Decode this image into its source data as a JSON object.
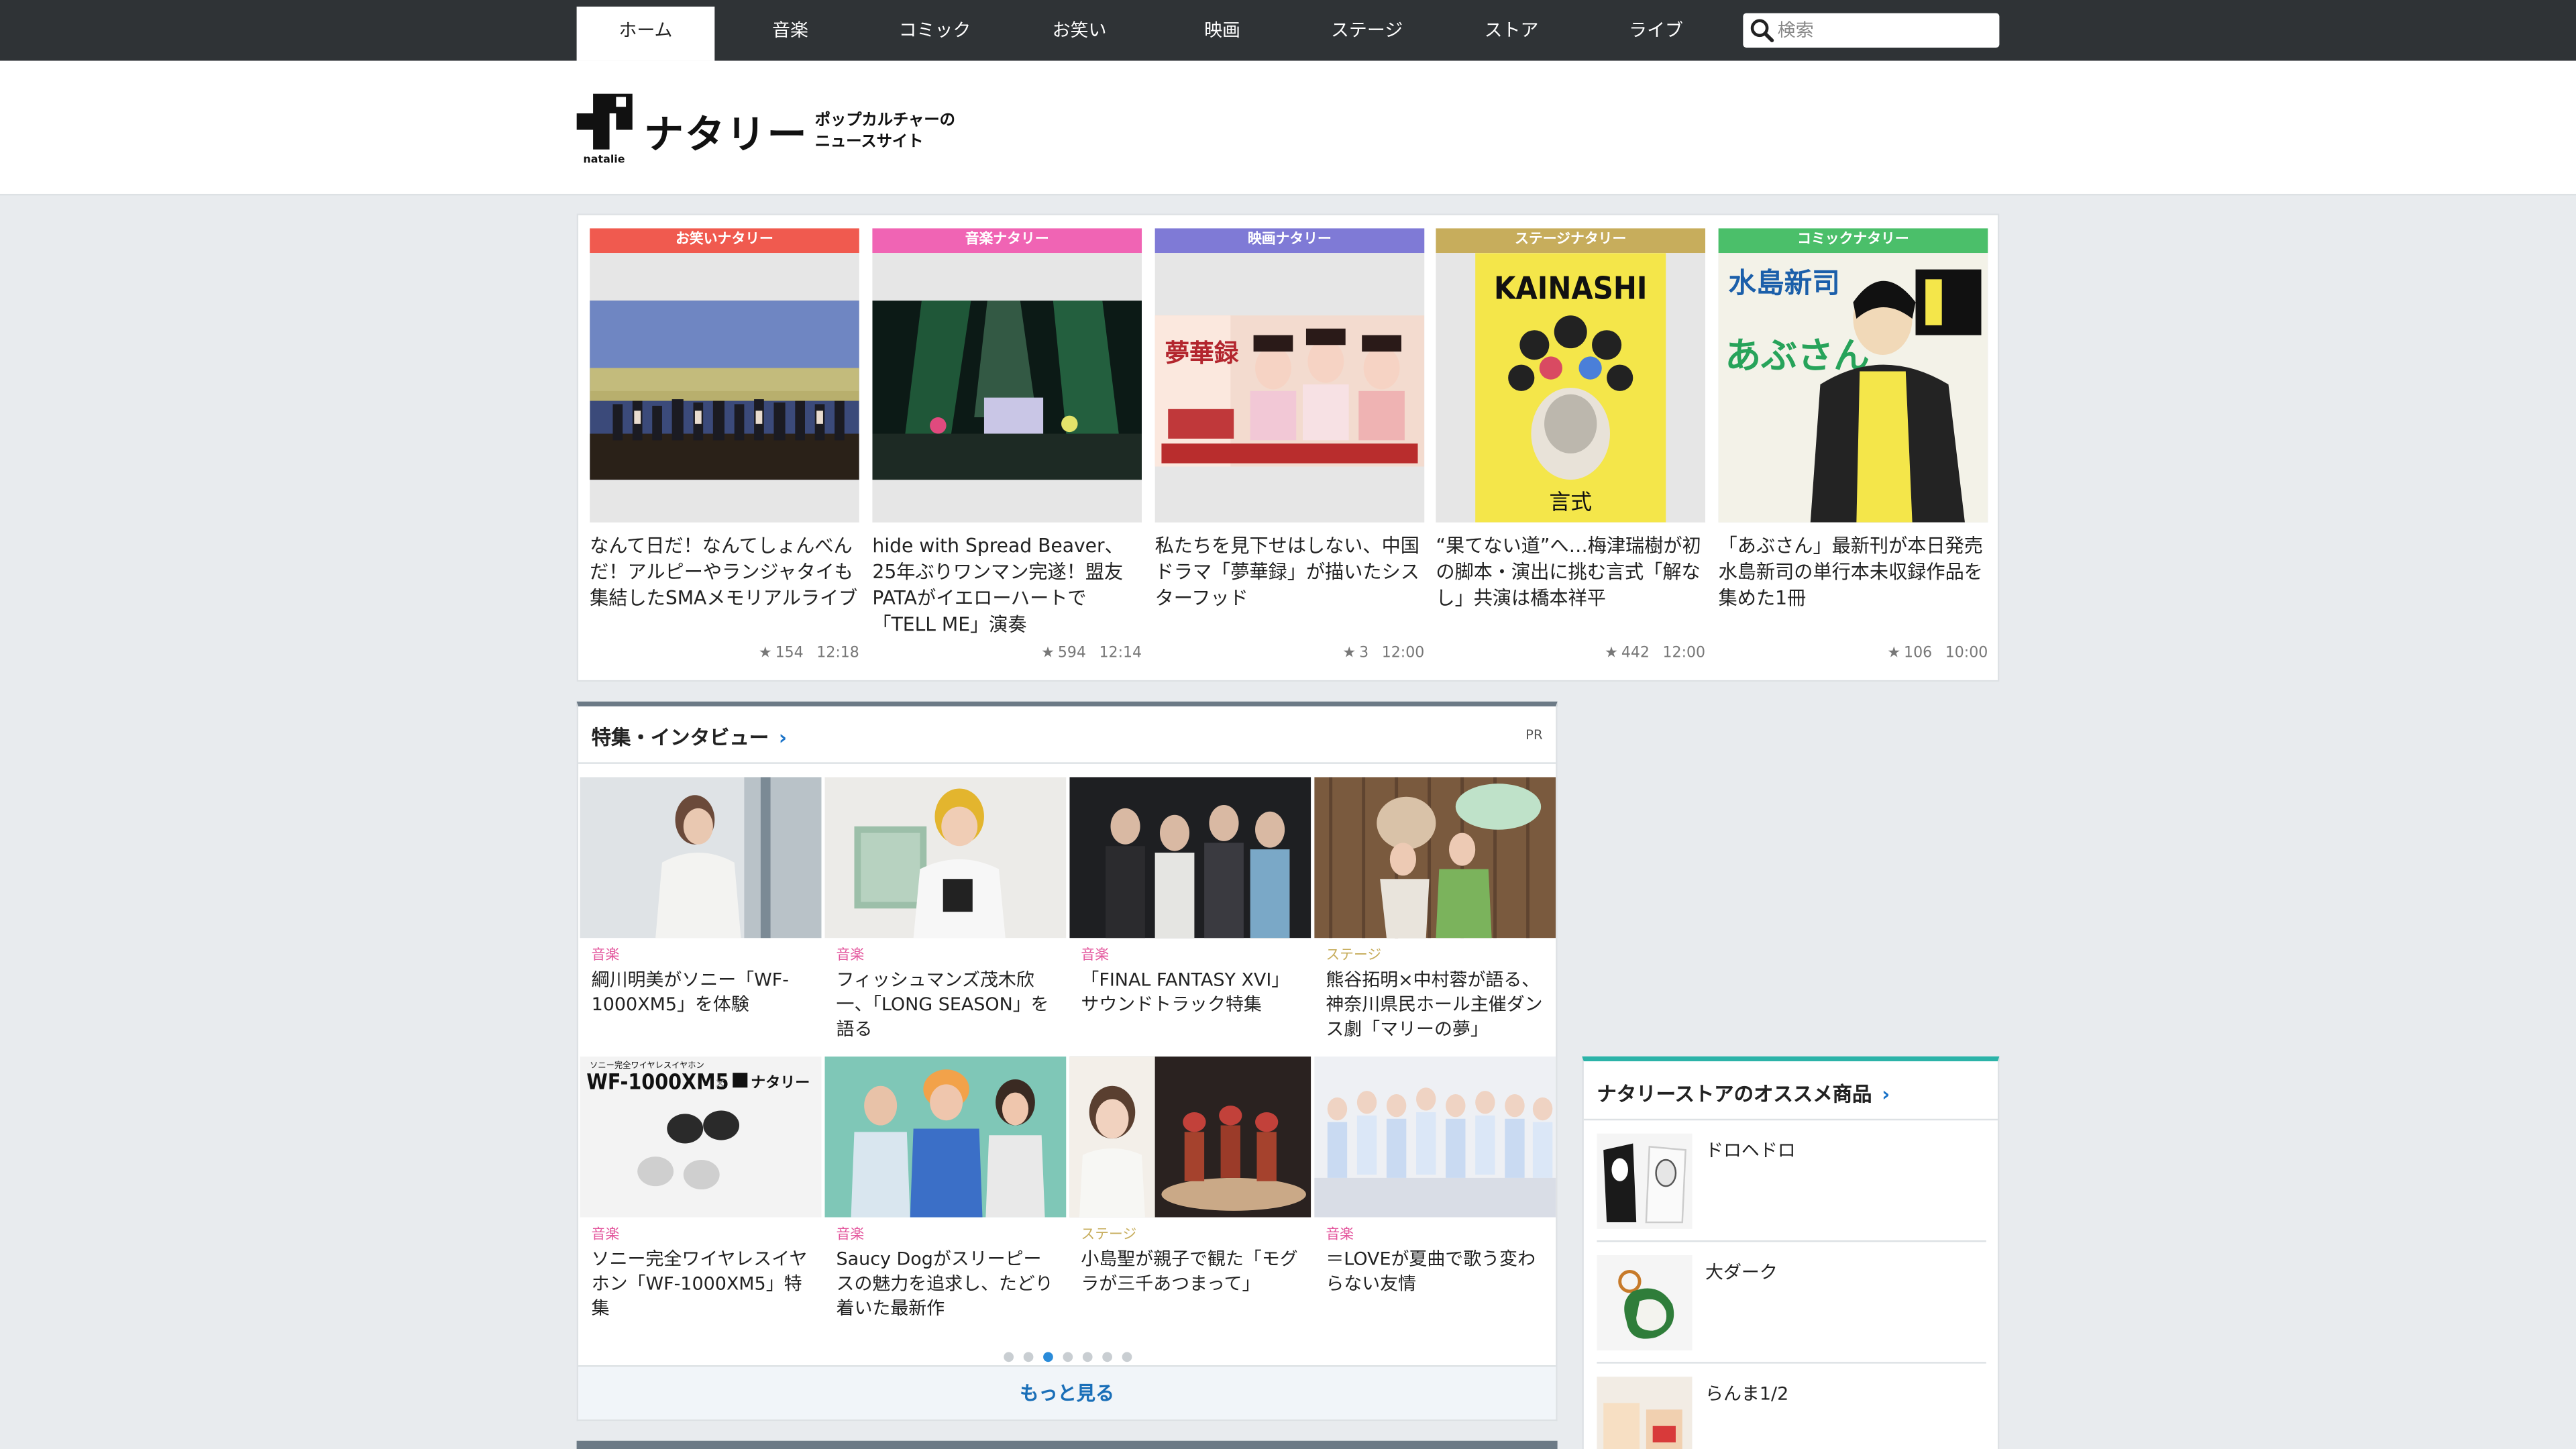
{
  "nav": {
    "tabs": [
      "ホーム",
      "音楽",
      "コミック",
      "お笑い",
      "映画",
      "ステージ",
      "ストア",
      "ライブ"
    ],
    "active_index": 0,
    "search_placeholder": "検索"
  },
  "header": {
    "logo_text": "ナタリー",
    "logo_sub": "natalie",
    "tagline_1": "ポップカルチャーの",
    "tagline_2": "ニュースサイト"
  },
  "picks": [
    {
      "badge": "お笑いナタリー",
      "badge_color": "#f05a4f",
      "title": "なんて日だ！なんてしょんべんだ！アルピーやランジャタイも集結したSMAメモリアルライブ",
      "count": "154",
      "time": "12:18"
    },
    {
      "badge": "音楽ナタリー",
      "badge_color": "#f064b4",
      "title": "hide with Spread Beaver、25年ぶりワンマン完遂！盟友PATAがイエローハートで「TELL ME」演奏",
      "count": "594",
      "time": "12:14"
    },
    {
      "badge": "映画ナタリー",
      "badge_color": "#7f7ad6",
      "title": "私たちを見下せはしない、中国ドラマ「夢華録」が描いたシスターフッド",
      "count": "3",
      "time": "12:00"
    },
    {
      "badge": "ステージナタリー",
      "badge_color": "#c7ad5c",
      "title": "“果てない道”へ…梅津瑞樹が初の脚本・演出に挑む言式「解なし」共演は橋本祥平",
      "count": "442",
      "time": "12:00"
    },
    {
      "badge": "コミックナタリー",
      "badge_color": "#4bbf6a",
      "title": "「あぶさん」最新刊が本日発売　水島新司の単行本未収録作品を集めた1冊",
      "count": "106",
      "time": "10:00"
    }
  ],
  "features": {
    "heading": "特集・インタビュー",
    "pr": "PR",
    "items": [
      {
        "cat": "音楽",
        "cat_color": "#e3559c",
        "title": "綱川明美がソニー「WF-1000XM5」を体験"
      },
      {
        "cat": "音楽",
        "cat_color": "#e3559c",
        "title": "フィッシュマンズ茂木欣一、「LONG SEASON」を語る"
      },
      {
        "cat": "音楽",
        "cat_color": "#e3559c",
        "title": "「FINAL FANTASY XVI」サウンドトラック特集"
      },
      {
        "cat": "ステージ",
        "cat_color": "#c7ad5c",
        "title": "熊谷拓明×中村蓉が語る、神奈川県民ホール主催ダンス劇「マリーの夢」"
      },
      {
        "cat": "音楽",
        "cat_color": "#e3559c",
        "title": "ソニー完全ワイヤレスイヤホン「WF-1000XM5」特集"
      },
      {
        "cat": "音楽",
        "cat_color": "#e3559c",
        "title": "Saucy Dogがスリーピースの魅力を追求し、たどり着いた最新作"
      },
      {
        "cat": "ステージ",
        "cat_color": "#c7ad5c",
        "title": "小島聖が親子で観た「モグラが三千あつまって」"
      },
      {
        "cat": "音楽",
        "cat_color": "#e3559c",
        "title": "＝LOVEが夏曲で歌う変わらない友情"
      }
    ],
    "banner_text": "WF-1000XM5",
    "banner_sub": "ソニー完全ワイヤレスイヤホン",
    "banner_logo": "ナタリー",
    "book_text": "KAINASHI",
    "book_sub": "言式",
    "manga_title": "あぶさん",
    "manga_author": "水島新司",
    "drama_title": "夢華録",
    "dots_total": 7,
    "dots_active": 2,
    "more": "もっと見る"
  },
  "store": {
    "heading": "ナタリーストアのオススメ商品",
    "items": [
      "ドロヘドロ",
      "大ダーク",
      "らんま1/2"
    ]
  }
}
